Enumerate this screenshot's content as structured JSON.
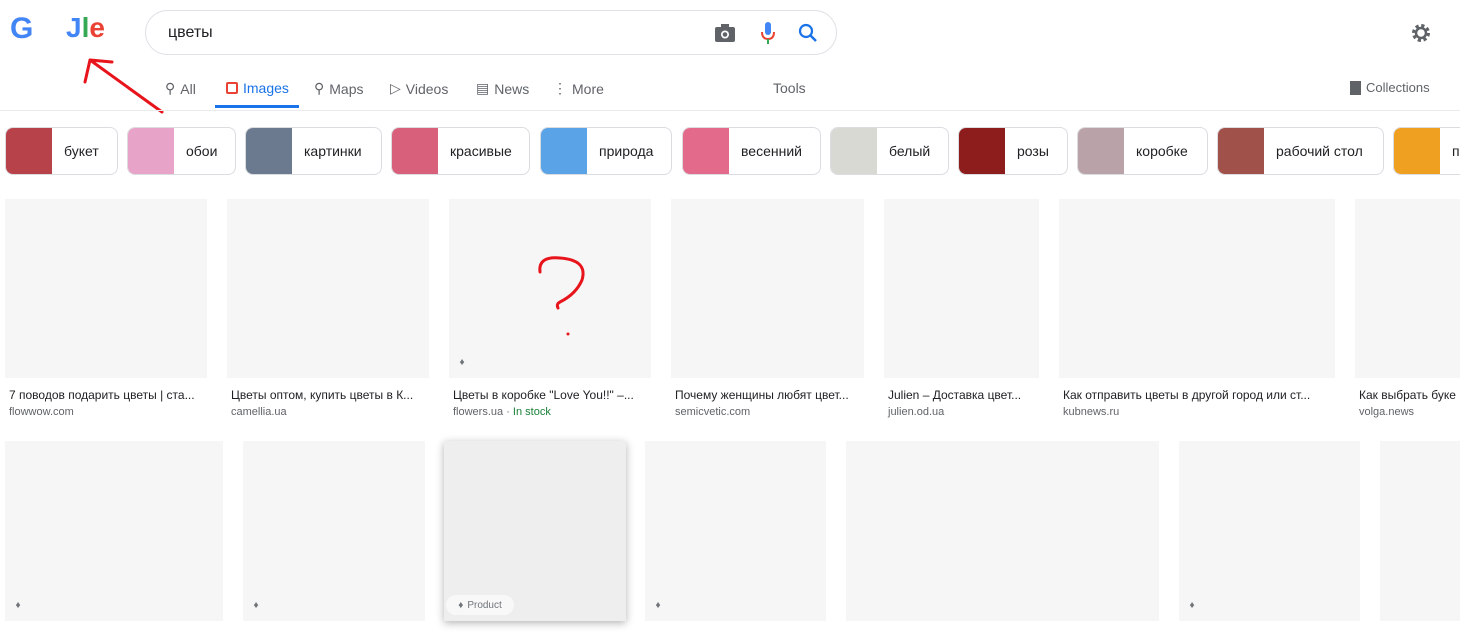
{
  "logo": {
    "text_left": "G",
    "text_right_1": "J",
    "text_right_2": "l",
    "text_right_3": "e"
  },
  "search": {
    "value": "цветы"
  },
  "tabs": [
    {
      "label": "All",
      "icon": "search-icon"
    },
    {
      "label": "Images",
      "icon": "image-icon",
      "active": true
    },
    {
      "label": "Maps",
      "icon": "map-pin-icon"
    },
    {
      "label": "Videos",
      "icon": "play-icon"
    },
    {
      "label": "News",
      "icon": "news-icon"
    },
    {
      "label": "More",
      "icon": "more-vert-icon"
    }
  ],
  "tools": "Tools",
  "collections": "Collections",
  "chips": [
    {
      "label": "букет",
      "color": "#b8424a"
    },
    {
      "label": "обои",
      "color": "#e7a3c8"
    },
    {
      "label": "картинки",
      "color": "#6b7a8e"
    },
    {
      "label": "красивые",
      "color": "#d8607b"
    },
    {
      "label": "природа",
      "color": "#5aa3e6"
    },
    {
      "label": "весенний",
      "color": "#e46a8b"
    },
    {
      "label": "белый",
      "color": "#d9d9d4"
    },
    {
      "label": "розы",
      "color": "#8d1c1c"
    },
    {
      "label": "коробке",
      "color": "#b9a3a8"
    },
    {
      "label": "рабочий стол",
      "color": "#a0524a"
    },
    {
      "label": "п",
      "color": "#f0a020"
    }
  ],
  "row1": [
    {
      "title": "7 поводов подарить цветы | ста...",
      "source": "flowwow.com"
    },
    {
      "title": "Цветы оптом, купить цветы в К...",
      "source": "camellia.ua"
    },
    {
      "title": "Цветы в коробке \"Love You!!\" –...",
      "source": "flowers.ua",
      "stock": "In stock",
      "tag": true
    },
    {
      "title": "Почему женщины любят цвет...",
      "source": "semicvetic.com"
    },
    {
      "title": "Julien – Доставка цвет...",
      "source": "julien.od.ua"
    },
    {
      "title": "Как отправить цветы в другой город или ст...",
      "source": "kubnews.ru"
    },
    {
      "title": "Как выбрать буке",
      "source": "volga.news"
    }
  ],
  "product_label": "Product",
  "annotation": {
    "question_mark": "?"
  },
  "colors": {
    "accent": "#1a73e8",
    "annotation": "#e8141c",
    "stock": "#188038"
  }
}
